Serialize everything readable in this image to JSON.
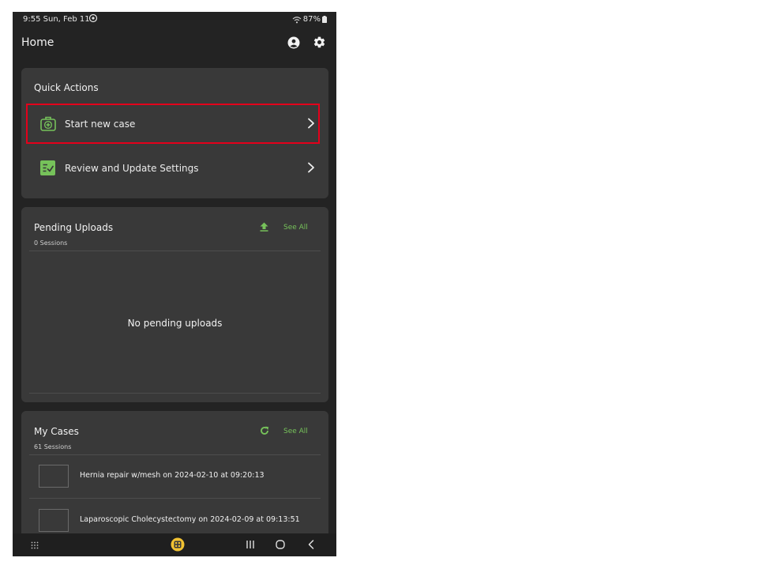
{
  "status_bar": {
    "time_date": "9:55  Sun, Feb 11",
    "battery": "87%"
  },
  "app_bar": {
    "title": "Home"
  },
  "quick_actions": {
    "title": "Quick Actions",
    "items": [
      {
        "label": "Start new case",
        "icon": "medical-kit-icon"
      },
      {
        "label": "Review and Update Settings",
        "icon": "checklist-icon"
      }
    ]
  },
  "pending_uploads": {
    "title": "Pending Uploads",
    "count": "0 Sessions",
    "see_all": "See All",
    "empty_message": "No pending uploads"
  },
  "my_cases": {
    "title": "My Cases",
    "count": "61 Sessions",
    "see_all": "See All",
    "items": [
      {
        "title": "Hernia repair w/mesh on 2024-02-10 at 09:20:13"
      },
      {
        "title": "Laparoscopic Cholecystectomy on 2024-02-09 at 09:13:51"
      }
    ]
  },
  "colors": {
    "accent": "#76c25a",
    "highlight": "#e4001b",
    "card": "#393939",
    "background": "#232323"
  }
}
